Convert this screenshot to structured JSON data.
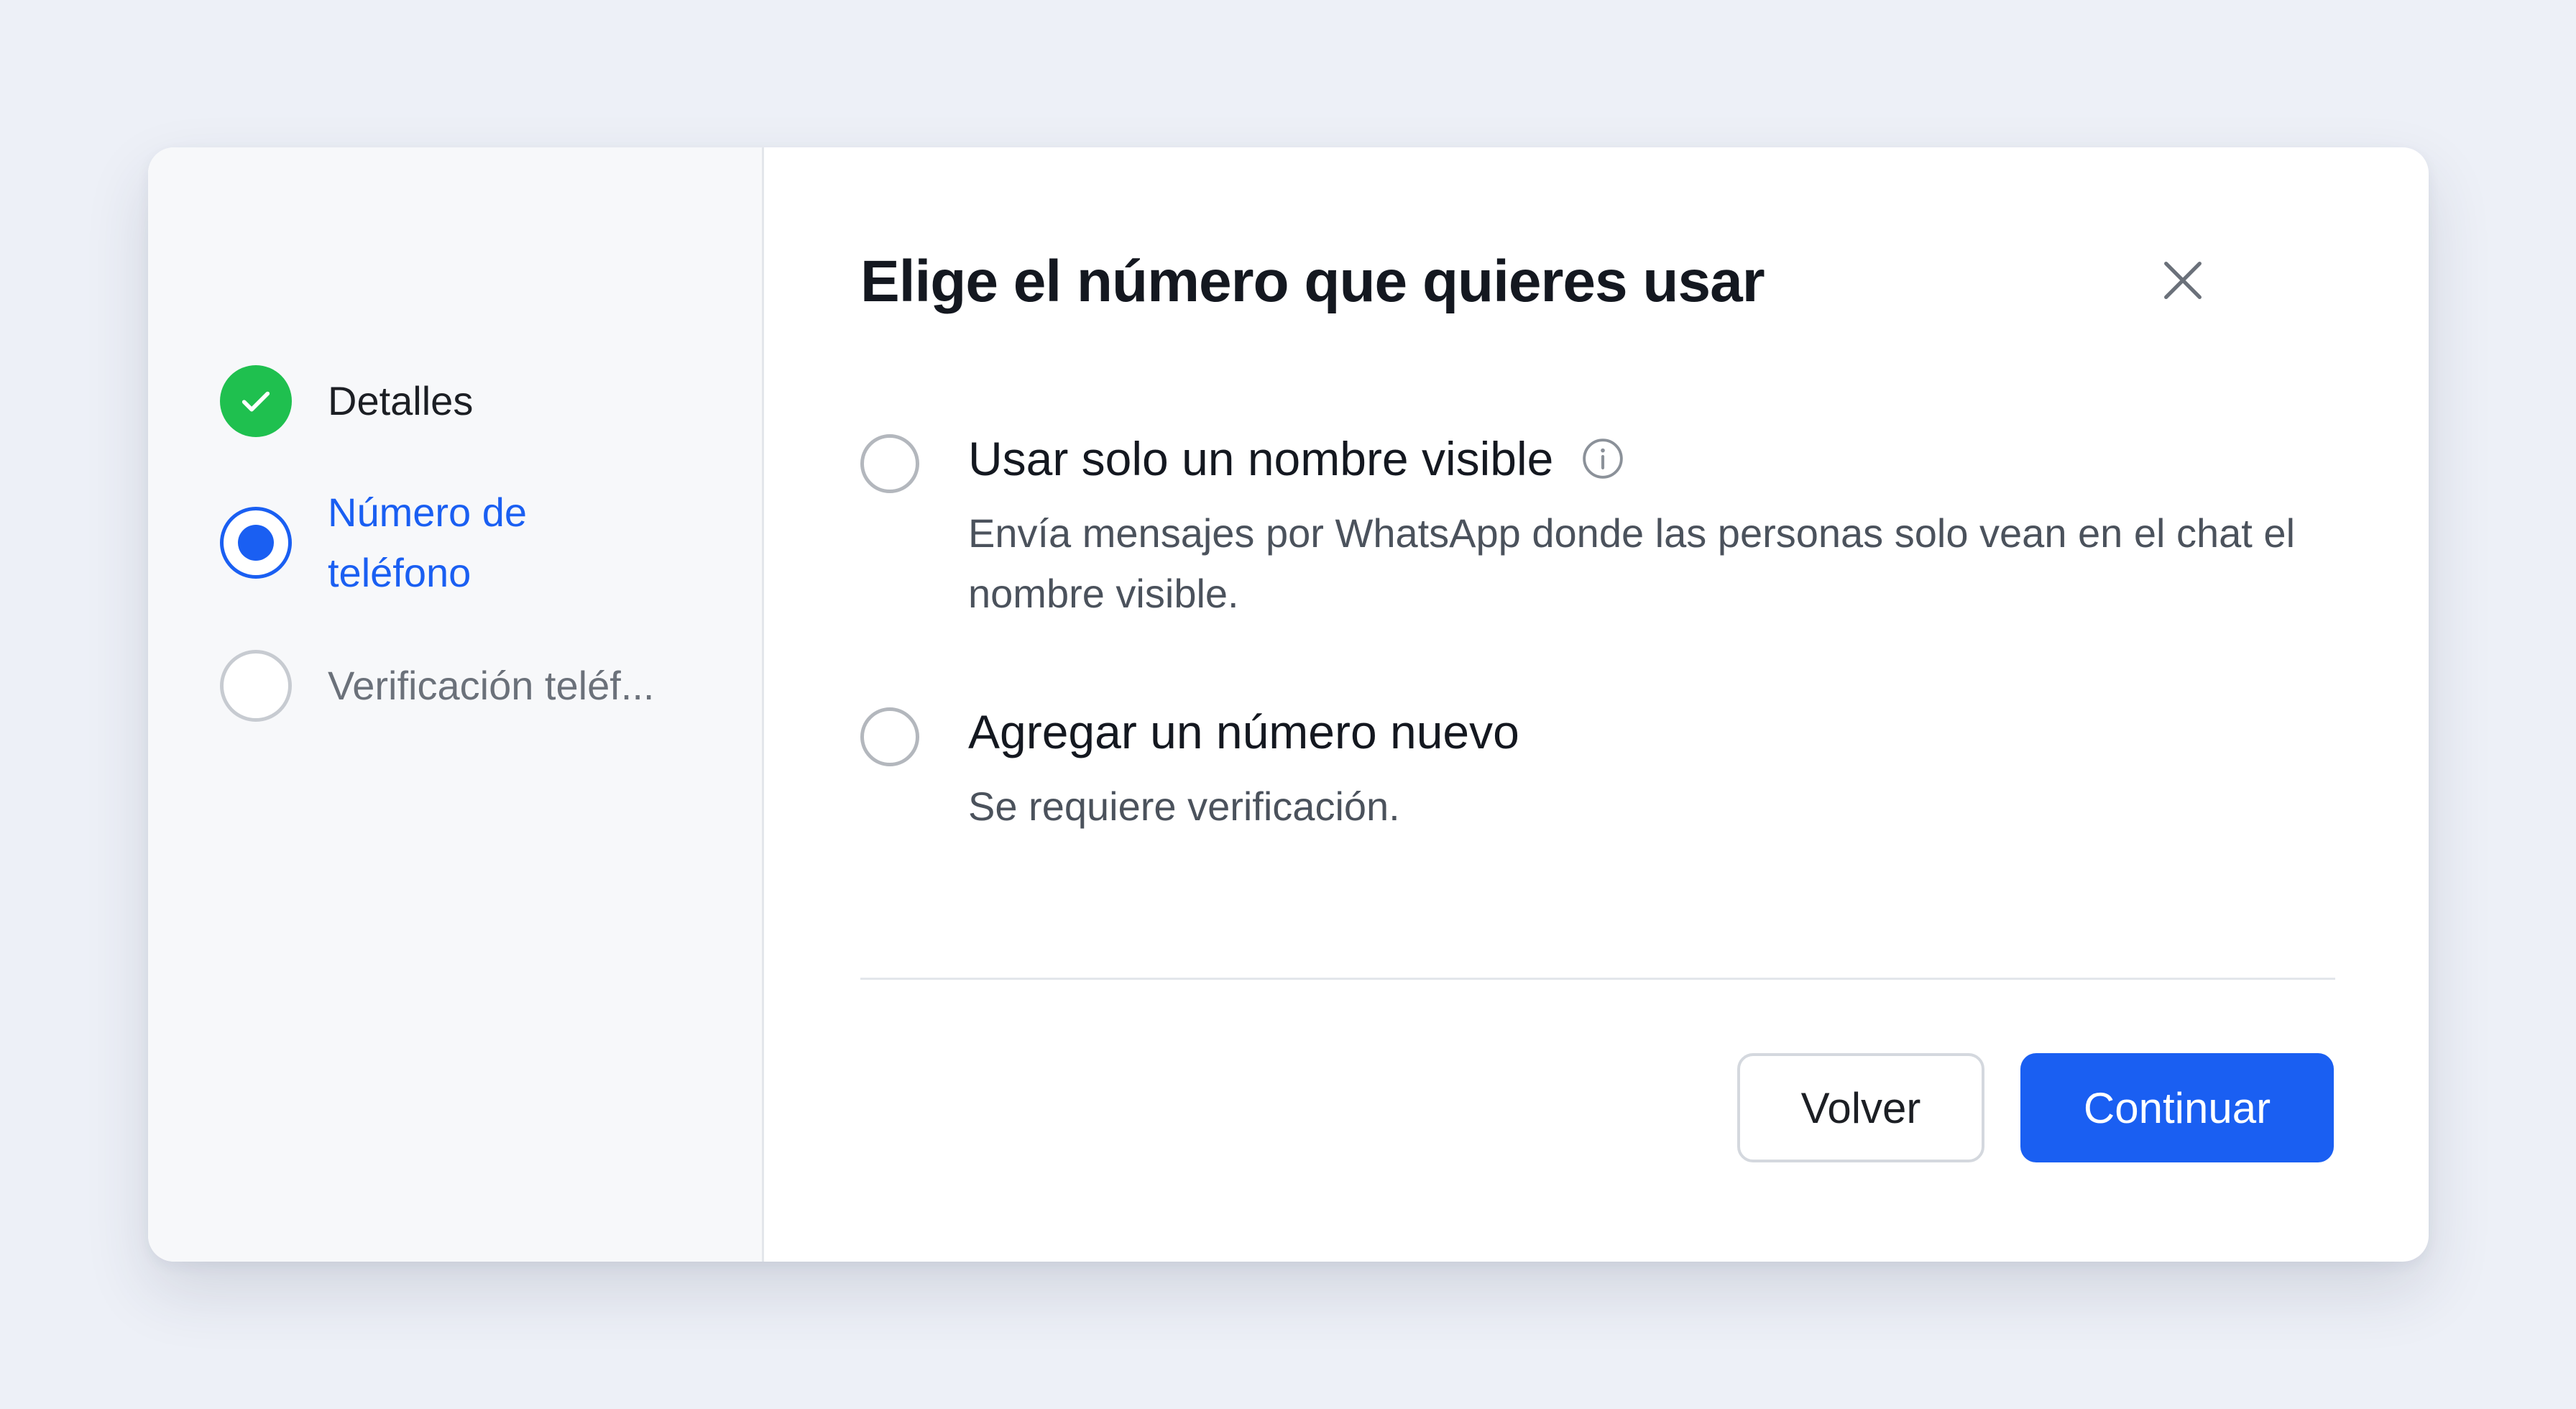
{
  "stepper": {
    "steps": [
      {
        "label": "Detalles",
        "state": "done",
        "icon": "check-icon"
      },
      {
        "label": "Número de teléfono",
        "state": "active"
      },
      {
        "label": "Verificación teléf...",
        "state": "todo"
      }
    ]
  },
  "dialog": {
    "title": "Elige el número que quieres usar",
    "close_icon": "close-icon",
    "options": [
      {
        "title": "Usar solo un nombre visible",
        "description": "Envía mensajes por WhatsApp donde las personas solo vean en el chat el nombre visible.",
        "info_icon": "info-icon",
        "selected": false
      },
      {
        "title": "Agregar un número nuevo",
        "description": "Se requiere verificación.",
        "selected": false
      }
    ],
    "buttons": {
      "back_label": "Volver",
      "continue_label": "Continuar"
    }
  },
  "colors": {
    "accent": "#1a5ff2",
    "success": "#1fc04f",
    "page_bg": "#edf0f7"
  }
}
